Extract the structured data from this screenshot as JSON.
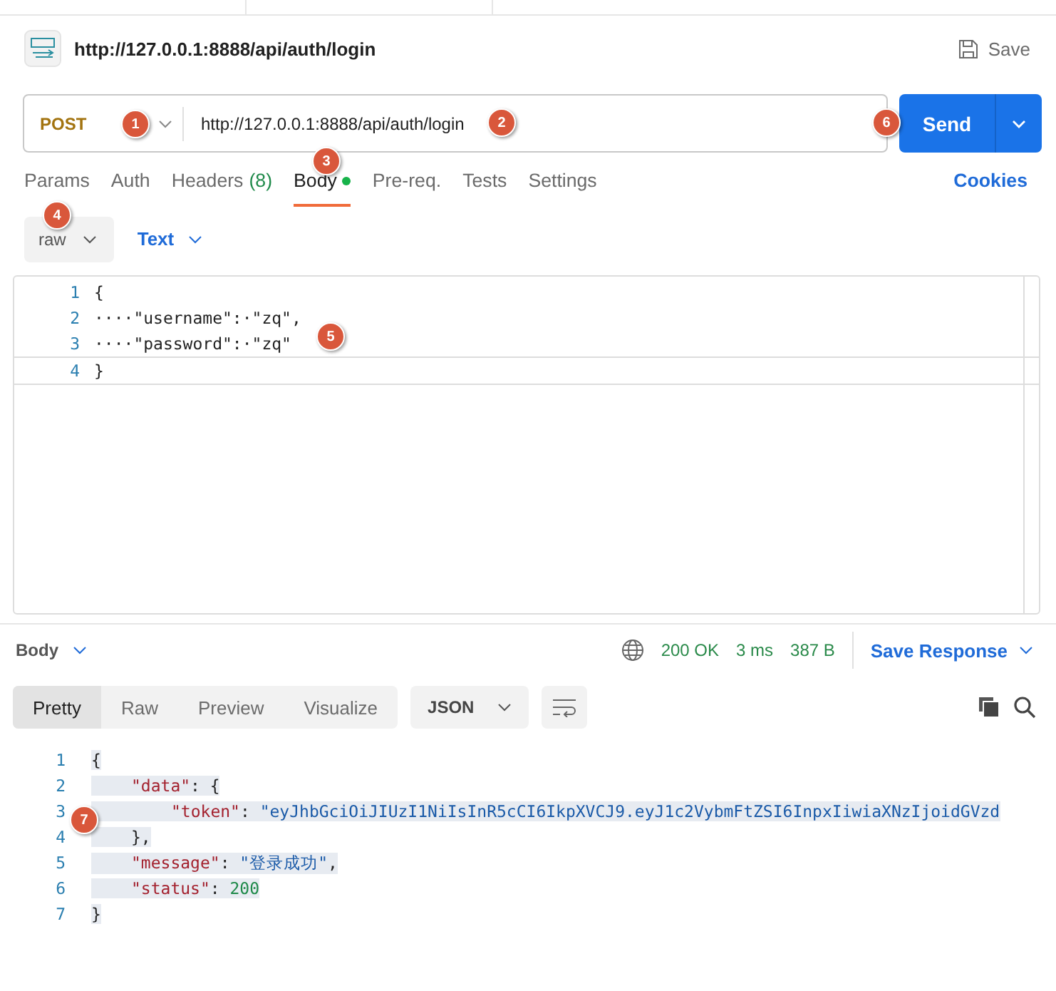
{
  "request": {
    "title": "http://127.0.0.1:8888/api/auth/login",
    "save": "Save",
    "method": "POST",
    "url": "http://127.0.0.1:8888/api/auth/login",
    "send": "Send",
    "tabs": [
      {
        "label": "Params",
        "selected": false
      },
      {
        "label": "Auth",
        "selected": false
      },
      {
        "label": "Headers",
        "count": "(8)",
        "selected": false
      },
      {
        "label": "Body",
        "dot": true,
        "selected": true
      },
      {
        "label": "Pre-req.",
        "selected": false
      },
      {
        "label": "Tests",
        "selected": false
      },
      {
        "label": "Settings",
        "selected": false
      }
    ],
    "cookies": "Cookies",
    "body_mode": "raw",
    "body_format": "Text",
    "editor_lines": [
      {
        "number": "1",
        "text": "{"
      },
      {
        "number": "2",
        "text": "····\"username\":·\"zq\","
      },
      {
        "number": "3",
        "text": "····\"password\":·\"zq\""
      },
      {
        "number": "4",
        "text": "}"
      }
    ]
  },
  "response": {
    "section": "Body",
    "status": "200 OK",
    "time": "3 ms",
    "size": "387 B",
    "save_response": "Save Response",
    "views": [
      {
        "label": "Pretty",
        "selected": true
      },
      {
        "label": "Raw",
        "selected": false
      },
      {
        "label": "Preview",
        "selected": false
      },
      {
        "label": "Visualize",
        "selected": false
      }
    ],
    "format": "JSON",
    "lines": [
      {
        "number": "1",
        "tokens": [
          {
            "kind": "punct",
            "text": "{"
          }
        ],
        "children": [
          {
            "number": "2",
            "tokens": [
              {
                "kind": "key",
                "text": "\"data\""
              },
              {
                "kind": "punct",
                "text": ": {"
              }
            ],
            "children": [
              {
                "number": "3",
                "tokens": [
                  {
                    "kind": "key",
                    "text": "\"token\""
                  },
                  {
                    "kind": "punct",
                    "text": ": "
                  },
                  {
                    "kind": "str",
                    "text": "\"eyJhbGciOiJIUzI1NiIsInR5cCI6IkpXVCJ9.eyJ1c2VybmFtZSI6InpxIiwiaXNzIjoidGVzd"
                  }
                ]
              }
            ]
          },
          {
            "number": "4",
            "tokens": [
              {
                "kind": "punct",
                "text": "},"
              }
            ]
          },
          {
            "number": "5",
            "tokens": [
              {
                "kind": "key",
                "text": "\"message\""
              },
              {
                "kind": "punct",
                "text": ": "
              },
              {
                "kind": "str",
                "text": "\"登录成功\""
              },
              {
                "kind": "punct",
                "text": ","
              }
            ]
          },
          {
            "number": "6",
            "tokens": [
              {
                "kind": "key",
                "text": "\"status\""
              },
              {
                "kind": "punct",
                "text": ": "
              },
              {
                "kind": "num",
                "text": "200"
              }
            ]
          }
        ]
      },
      {
        "number": "7",
        "tokens": [
          {
            "kind": "punct",
            "text": "}"
          }
        ]
      }
    ]
  },
  "badges": [
    "1",
    "2",
    "3",
    "4",
    "5",
    "6",
    "7"
  ]
}
